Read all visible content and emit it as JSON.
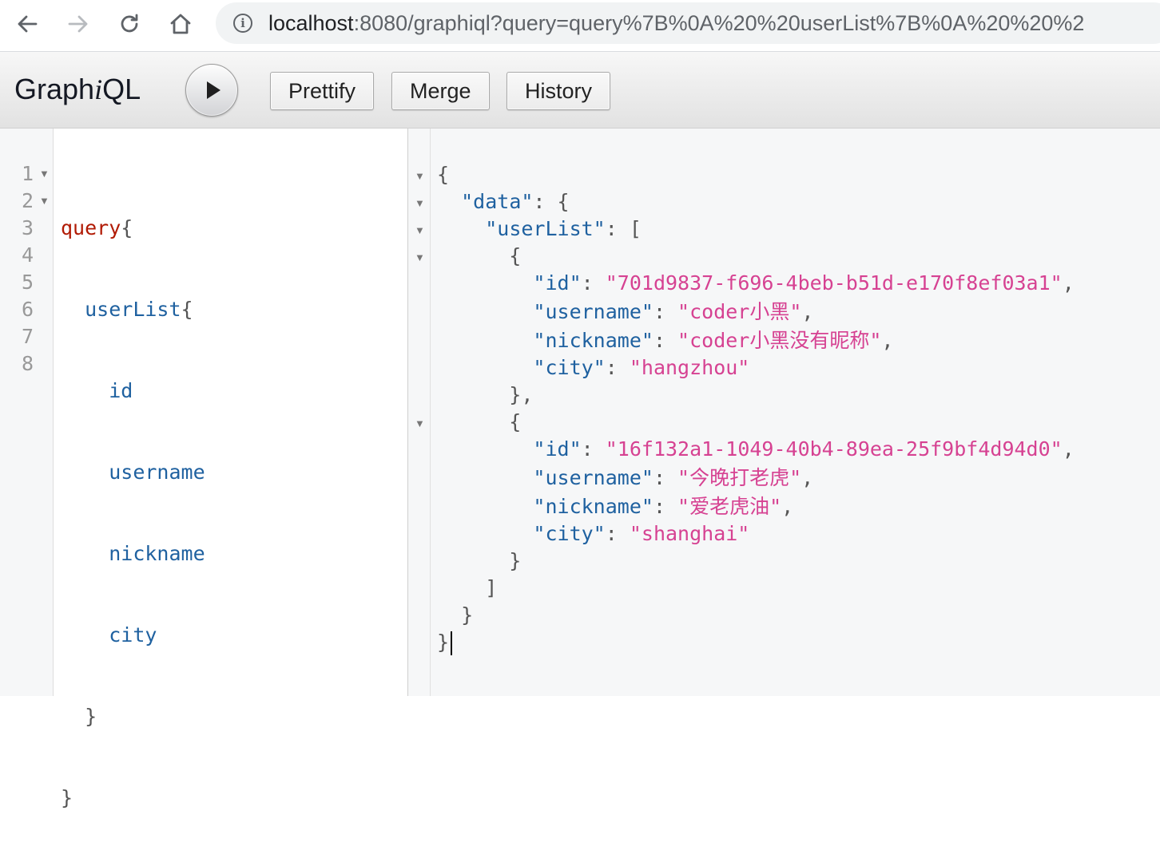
{
  "browser": {
    "back_icon": "arrow-left-icon",
    "forward_icon": "arrow-right-icon",
    "reload_icon": "reload-icon",
    "home_icon": "home-icon",
    "url_host": "localhost",
    "url_rest": ":8080/graphiql?query=query%7B%0A%20%20userList%7B%0A%20%20%2"
  },
  "toolbar": {
    "title_prefix": "Graph",
    "title_italic": "i",
    "title_suffix": "QL",
    "run_icon": "play-icon",
    "prettify_label": "Prettify",
    "merge_label": "Merge",
    "history_label": "History"
  },
  "query_editor": {
    "line_numbers": [
      "1",
      "2",
      "3",
      "4",
      "5",
      "6",
      "7",
      "8"
    ],
    "lines": [
      {
        "keyword": "query",
        "punct": "{"
      },
      {
        "indent": "  ",
        "def": "userList",
        "punct": "{"
      },
      {
        "indent": "    ",
        "def": "id"
      },
      {
        "indent": "    ",
        "def": "username"
      },
      {
        "indent": "    ",
        "def": "nickname"
      },
      {
        "indent": "    ",
        "def": "city"
      },
      {
        "indent": "  ",
        "punct": "}"
      },
      {
        "punct": "}"
      }
    ]
  },
  "result": {
    "open_brace": "{",
    "data_key": "\"data\"",
    "userlist_key": "\"userList\"",
    "users": [
      {
        "id": "\"701d9837-f696-4beb-b51d-e170f8ef03a1\"",
        "username": "\"coder小黑\"",
        "nickname": "\"coder小黑没有昵称\"",
        "city": "\"hangzhou\""
      },
      {
        "id": "\"16f132a1-1049-40b4-89ea-25f9bf4d94d0\"",
        "username": "\"今晚打老虎\"",
        "nickname": "\"爱老虎油\"",
        "city": "\"shanghai\""
      }
    ],
    "key_id": "\"id\"",
    "key_username": "\"username\"",
    "key_nickname": "\"nickname\"",
    "key_city": "\"city\""
  },
  "colors": {
    "keyword": "#b11a04",
    "definition": "#1f61a0",
    "string": "#d64292",
    "punctuation": "#555555"
  }
}
